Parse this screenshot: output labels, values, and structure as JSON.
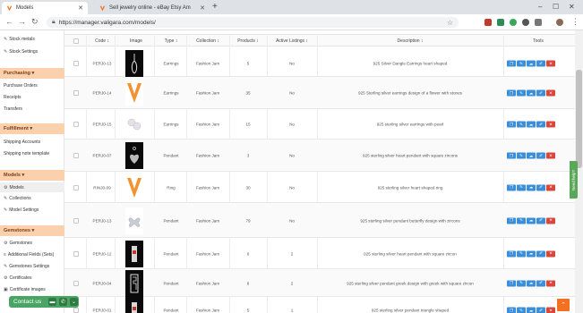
{
  "browser": {
    "tabs": [
      {
        "label": "Models",
        "active": true
      },
      {
        "label": "Sell jewelry online - eBay Etsy Am",
        "active": false
      }
    ],
    "url": "https://manager.valigara.com/models/",
    "colors": {
      "accent": "#f36f21",
      "sidebar_head": "#fbd1ad",
      "tool_blue": "#3b8fd9",
      "tool_red": "#d9463b"
    }
  },
  "sidebar": {
    "items_top": [
      {
        "label": "Stock metals",
        "icon": "pencil-icon"
      },
      {
        "label": "Stock Settings",
        "icon": "wrench-icon"
      }
    ],
    "purchasing": {
      "title": "Purchasing ▾",
      "items": [
        "Purchase Orders",
        "Receipts",
        "Transfers"
      ]
    },
    "fulfillment": {
      "title": "Fulfillment ▾",
      "items": [
        "Shipping Accounts",
        "Shipping note template"
      ]
    },
    "models": {
      "title": "Models ▾",
      "items": [
        "Models",
        "Collections",
        "Model Settings"
      ]
    },
    "gemstones": {
      "title": "Gemstones ▾",
      "items": [
        "Gemstones",
        "Additional Fields (Sets)",
        "Gemstones Settings",
        "Certificates",
        "Certificate images"
      ]
    }
  },
  "table": {
    "headers": {
      "code": "Code ↕",
      "image": "Image",
      "type": "Type ↕",
      "collection": "Collection ↕",
      "products": "Products ↕",
      "active": "Active Listings ↕",
      "description": "Description ↕",
      "tools": "Tools"
    },
    "rows": [
      {
        "code": "PERJ0-13",
        "type": "Earrings",
        "collection": "Fashion Jam",
        "products": "5",
        "active": "No",
        "description": "925 Silver Dangle Earrings heart shaped"
      },
      {
        "code": "PERJ0-14",
        "type": "Earrings",
        "collection": "Fashion Jam",
        "products": "35",
        "active": "No",
        "description": "925 Sterling silver earrings design of a flower with stones"
      },
      {
        "code": "PERJ0-15",
        "type": "Earrings",
        "collection": "Fashion Jam",
        "products": "15",
        "active": "No",
        "description": "925 sterling silver earrings with pearl"
      },
      {
        "code": "PERJ0-07",
        "type": "Pendant",
        "collection": "Fashion Jam",
        "products": "3",
        "active": "No",
        "description": "925 sterling silver heart pendant with square zircons"
      },
      {
        "code": "RINJ0-09",
        "type": "Ring",
        "collection": "Fashion Jam",
        "products": "30",
        "active": "No",
        "description": "925 sterling silver heart shaped ring"
      },
      {
        "code": "PERJ0-13",
        "type": "Pendant",
        "collection": "Fashion Jam",
        "products": "79",
        "active": "No",
        "description": "925 sterling silver pendant butterfly design with zircons"
      },
      {
        "code": "PERJ0-12",
        "type": "Pendant",
        "collection": "Fashion Jam",
        "products": "6",
        "active": "2",
        "description": "925 sterling silver heart pendant with square zircon"
      },
      {
        "code": "PERJ0-04",
        "type": "Pendant",
        "collection": "Fashion Jam",
        "products": "6",
        "active": "2",
        "description": "925 sterling silver pendant greek design with greek with square zircon"
      },
      {
        "code": "PERJ0-01",
        "type": "Pendant",
        "collection": "Fashion Jam",
        "products": "5",
        "active": "1",
        "description": "925 sterling silver pendant triangle shaped"
      }
    ]
  },
  "floating": {
    "contact": "Contact us",
    "need_help": "Need help?"
  }
}
